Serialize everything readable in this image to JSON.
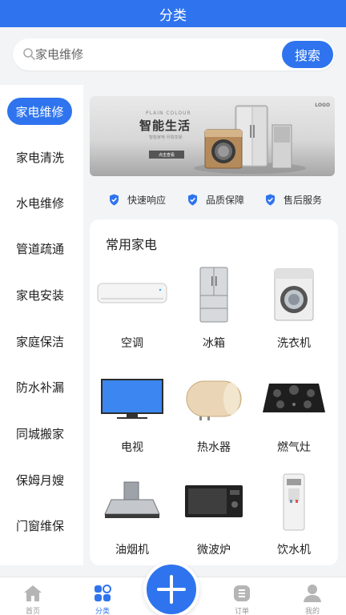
{
  "header": {
    "title": "分类"
  },
  "search": {
    "placeholder": "家电维修",
    "button_label": "搜索"
  },
  "sidebar": {
    "active_index": 0,
    "items": [
      {
        "label": "家电维修"
      },
      {
        "label": "家电清洗"
      },
      {
        "label": "水电维修"
      },
      {
        "label": "管道疏通"
      },
      {
        "label": "家电安装"
      },
      {
        "label": "家庭保洁"
      },
      {
        "label": "防水补漏"
      },
      {
        "label": "同城搬家"
      },
      {
        "label": "保姆月嫂"
      },
      {
        "label": "门窗维保"
      }
    ]
  },
  "banner": {
    "small_text": "PLAIN COLOUR",
    "logo": "LOGO",
    "title": "智能生活",
    "subtitle": "智能家电 尽情享受",
    "button_label": "点击查看"
  },
  "features": [
    {
      "label": "快速响应",
      "icon": "shield-check-icon"
    },
    {
      "label": "品质保障",
      "icon": "shield-check-icon"
    },
    {
      "label": "售后服务",
      "icon": "shield-check-icon"
    }
  ],
  "appliances": {
    "title": "常用家电",
    "items": [
      {
        "label": "空调",
        "icon": "air-conditioner-icon"
      },
      {
        "label": "冰箱",
        "icon": "refrigerator-icon"
      },
      {
        "label": "洗衣机",
        "icon": "washing-machine-icon"
      },
      {
        "label": "电视",
        "icon": "tv-icon"
      },
      {
        "label": "热水器",
        "icon": "water-heater-icon"
      },
      {
        "label": "燃气灶",
        "icon": "gas-stove-icon"
      },
      {
        "label": "油烟机",
        "icon": "range-hood-icon"
      },
      {
        "label": "微波炉",
        "icon": "microwave-icon"
      },
      {
        "label": "饮水机",
        "icon": "water-dispenser-icon"
      }
    ]
  },
  "tabbar": {
    "active_index": 1,
    "items": [
      {
        "label": "首页",
        "icon": "home-icon"
      },
      {
        "label": "分类",
        "icon": "category-icon"
      },
      {
        "label": "订单",
        "icon": "order-icon"
      },
      {
        "label": "我的",
        "icon": "user-icon"
      }
    ],
    "center_icon": "plus-icon"
  },
  "colors": {
    "primary": "#2f74ee",
    "background": "#f3f4f6"
  }
}
